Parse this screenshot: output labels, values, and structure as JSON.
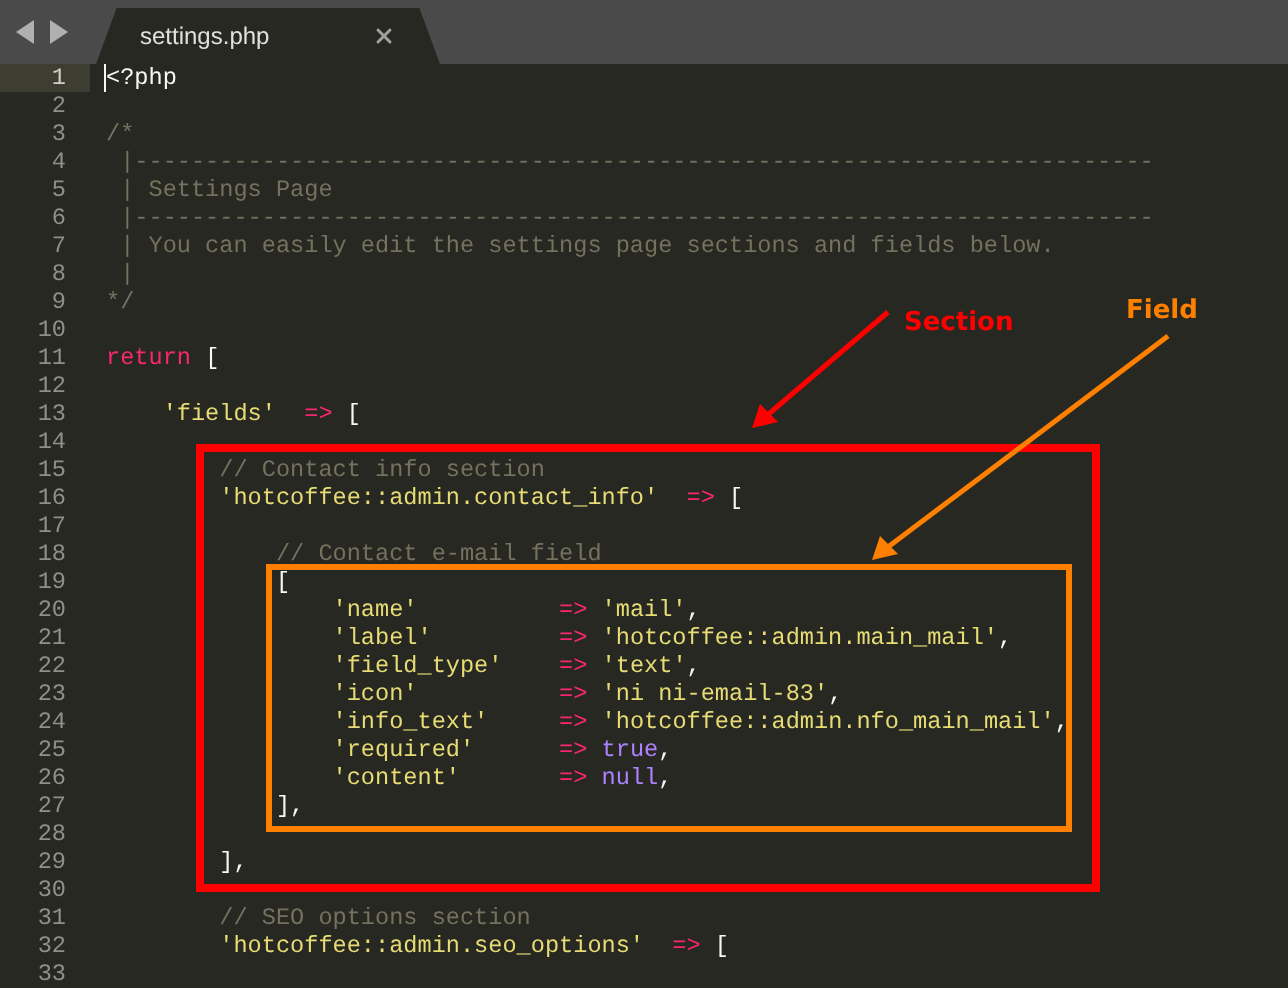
{
  "tab": {
    "title": "settings.php",
    "selected": true
  },
  "lines": [
    {
      "number": "1",
      "selected": true,
      "tokens": [
        {
          "kind": "plain",
          "text": "<?php"
        }
      ]
    },
    {
      "number": "2",
      "selected": false
    },
    {
      "number": "3",
      "selected": false,
      "tokens": [
        {
          "kind": "comment",
          "text": "/*"
        }
      ]
    },
    {
      "number": "4",
      "selected": false,
      "tokens": [
        {
          "kind": "comment",
          "text": " |------------------------------------------------------------------------"
        }
      ]
    },
    {
      "number": "5",
      "selected": false,
      "tokens": [
        {
          "kind": "comment",
          "text": " | Settings Page"
        }
      ]
    },
    {
      "number": "6",
      "selected": false,
      "tokens": [
        {
          "kind": "comment",
          "text": " |------------------------------------------------------------------------"
        }
      ]
    },
    {
      "number": "7",
      "selected": false,
      "tokens": [
        {
          "kind": "comment",
          "text": " | You can easily edit the settings page sections and fields below."
        }
      ]
    },
    {
      "number": "8",
      "selected": false,
      "tokens": [
        {
          "kind": "comment",
          "text": " |"
        }
      ]
    },
    {
      "number": "9",
      "selected": false,
      "tokens": [
        {
          "kind": "comment",
          "text": "*/"
        }
      ]
    },
    {
      "number": "10",
      "selected": false
    },
    {
      "number": "11",
      "selected": false,
      "tokens": [
        {
          "kind": "keyword",
          "text": "return"
        },
        {
          "kind": "plain",
          "text": " ["
        }
      ]
    },
    {
      "number": "12",
      "selected": false
    },
    {
      "number": "13",
      "selected": false,
      "tokens": [
        {
          "kind": "string",
          "text": "    'fields'"
        },
        {
          "kind": "keyword",
          "text": "  =>"
        },
        {
          "kind": "plain",
          "text": " ["
        }
      ]
    },
    {
      "number": "14",
      "selected": false
    },
    {
      "number": "15",
      "selected": false,
      "tokens": [
        {
          "kind": "comment",
          "text": "        // Contact info section"
        }
      ]
    },
    {
      "number": "16",
      "selected": false,
      "tokens": [
        {
          "kind": "string",
          "text": "        'hotcoffee::admin.contact_info'"
        },
        {
          "kind": "keyword",
          "text": "  =>"
        },
        {
          "kind": "plain",
          "text": " ["
        }
      ]
    },
    {
      "number": "17",
      "selected": false
    },
    {
      "number": "18",
      "selected": false,
      "tokens": [
        {
          "kind": "comment",
          "text": "            // Contact e-mail field"
        }
      ]
    },
    {
      "number": "19",
      "selected": false,
      "tokens": [
        {
          "kind": "plain",
          "text": "            ["
        }
      ]
    },
    {
      "number": "20",
      "selected": false,
      "tokens": [
        {
          "kind": "string",
          "text": "                'name'"
        },
        {
          "kind": "keyword",
          "text": "          =>"
        },
        {
          "kind": "string",
          "text": " 'mail'"
        },
        {
          "kind": "plain",
          "text": ","
        }
      ]
    },
    {
      "number": "21",
      "selected": false,
      "tokens": [
        {
          "kind": "string",
          "text": "                'label'"
        },
        {
          "kind": "keyword",
          "text": "         =>"
        },
        {
          "kind": "string",
          "text": " 'hotcoffee::admin.main_mail'"
        },
        {
          "kind": "plain",
          "text": ","
        }
      ]
    },
    {
      "number": "22",
      "selected": false,
      "tokens": [
        {
          "kind": "string",
          "text": "                'field_type'"
        },
        {
          "kind": "keyword",
          "text": "    =>"
        },
        {
          "kind": "string",
          "text": " 'text'"
        },
        {
          "kind": "plain",
          "text": ","
        }
      ]
    },
    {
      "number": "23",
      "selected": false,
      "tokens": [
        {
          "kind": "string",
          "text": "                'icon'"
        },
        {
          "kind": "keyword",
          "text": "          =>"
        },
        {
          "kind": "string",
          "text": " 'ni ni-email-83'"
        },
        {
          "kind": "plain",
          "text": ","
        }
      ]
    },
    {
      "number": "24",
      "selected": false,
      "tokens": [
        {
          "kind": "string",
          "text": "                'info_text'"
        },
        {
          "kind": "keyword",
          "text": "     =>"
        },
        {
          "kind": "string",
          "text": " 'hotcoffee::admin.nfo_main_mail'"
        },
        {
          "kind": "plain",
          "text": ","
        }
      ]
    },
    {
      "number": "25",
      "selected": false,
      "tokens": [
        {
          "kind": "string",
          "text": "                'required'"
        },
        {
          "kind": "keyword",
          "text": "      =>"
        },
        {
          "kind": "constant",
          "text": " true"
        },
        {
          "kind": "plain",
          "text": ","
        }
      ]
    },
    {
      "number": "26",
      "selected": false,
      "tokens": [
        {
          "kind": "string",
          "text": "                'content'"
        },
        {
          "kind": "keyword",
          "text": "       =>"
        },
        {
          "kind": "constant",
          "text": " null"
        },
        {
          "kind": "plain",
          "text": ","
        }
      ]
    },
    {
      "number": "27",
      "selected": false,
      "tokens": [
        {
          "kind": "plain",
          "text": "            ],"
        }
      ]
    },
    {
      "number": "28",
      "selected": false
    },
    {
      "number": "29",
      "selected": false,
      "tokens": [
        {
          "kind": "plain",
          "text": "        ],"
        }
      ]
    },
    {
      "number": "30",
      "selected": false
    },
    {
      "number": "31",
      "selected": false,
      "tokens": [
        {
          "kind": "comment",
          "text": "        // SEO options section"
        }
      ]
    },
    {
      "number": "32",
      "selected": false,
      "tokens": [
        {
          "kind": "string",
          "text": "        'hotcoffee::admin.seo_options'"
        },
        {
          "kind": "keyword",
          "text": "  =>"
        },
        {
          "kind": "plain",
          "text": " ["
        }
      ]
    },
    {
      "number": "33",
      "selected": false
    }
  ],
  "annotations": [
    {
      "label": "Section",
      "color": "#ff0000"
    },
    {
      "label": "Field",
      "color": "#ff8000"
    }
  ]
}
